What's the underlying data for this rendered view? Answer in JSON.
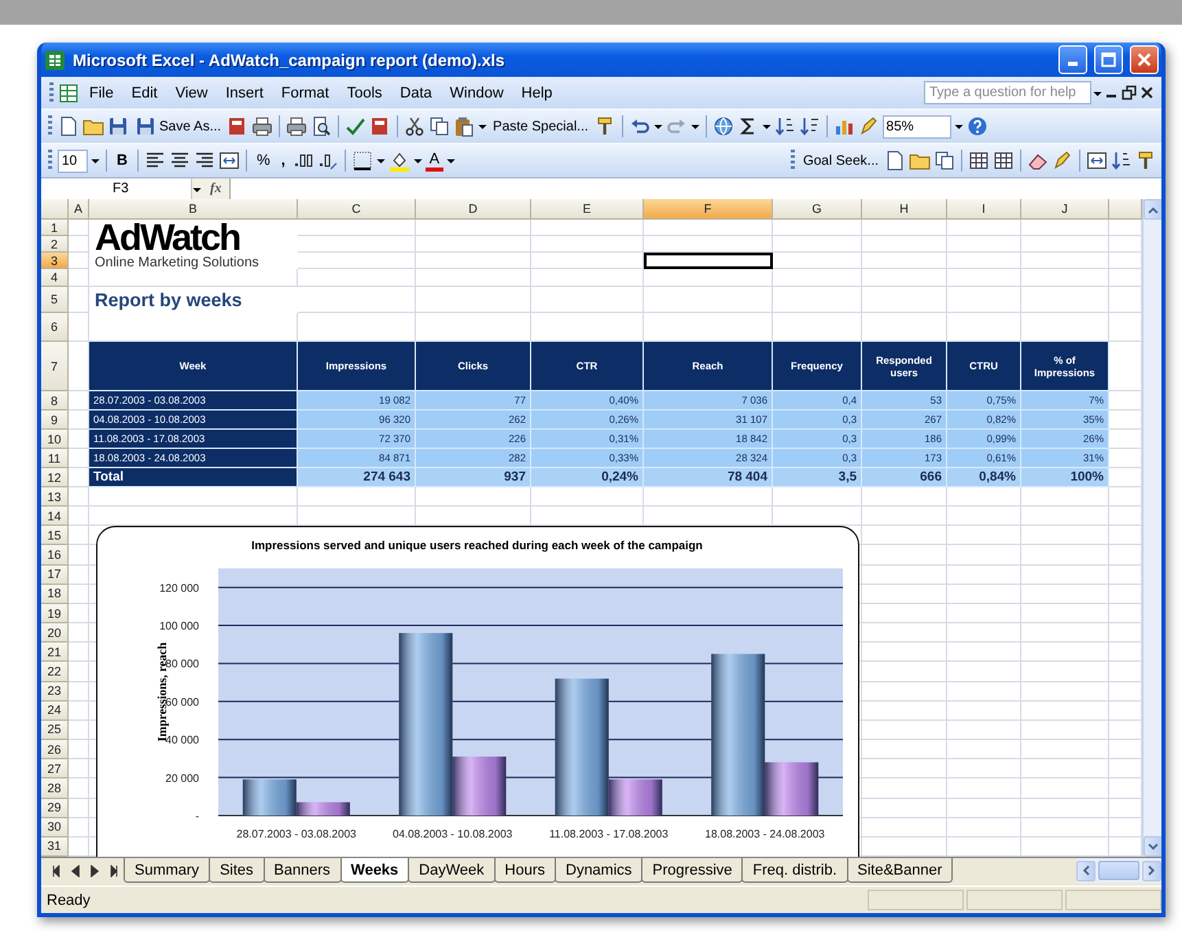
{
  "window": {
    "title": "Microsoft Excel - AdWatch_campaign report (demo).xls"
  },
  "menu": [
    "File",
    "Edit",
    "View",
    "Insert",
    "Format",
    "Tools",
    "Data",
    "Window",
    "Help"
  ],
  "help_box": {
    "placeholder": "Type a question for help"
  },
  "toolbar": {
    "save_as": "Save As...",
    "paste_special": "Paste Special...",
    "zoom": "85%"
  },
  "format_toolbar": {
    "font_size": "10",
    "bold": "B",
    "percent": "%",
    "comma": ",",
    "font_color": "A",
    "goal_seek": "Goal Seek..."
  },
  "formula_bar": {
    "name_box": "F3",
    "function": "fx"
  },
  "columns": [
    {
      "label": "A",
      "selected": false
    },
    {
      "label": "B",
      "selected": false
    },
    {
      "label": "C",
      "selected": false
    },
    {
      "label": "D",
      "selected": false
    },
    {
      "label": "E",
      "selected": false
    },
    {
      "label": "F",
      "selected": true
    },
    {
      "label": "G",
      "selected": false
    },
    {
      "label": "H",
      "selected": false
    },
    {
      "label": "I",
      "selected": false
    },
    {
      "label": "J",
      "selected": false
    }
  ],
  "rows": [
    {
      "label": "1",
      "selected": false
    },
    {
      "label": "2",
      "selected": false
    },
    {
      "label": "3",
      "selected": true
    },
    {
      "label": "4",
      "selected": false
    },
    {
      "label": "5",
      "selected": false
    },
    {
      "label": "6",
      "selected": false
    },
    {
      "label": "7",
      "selected": false
    },
    {
      "label": "8",
      "selected": false
    },
    {
      "label": "9",
      "selected": false
    },
    {
      "label": "10",
      "selected": false
    },
    {
      "label": "11",
      "selected": false
    },
    {
      "label": "12",
      "selected": false
    },
    {
      "label": "13",
      "selected": false
    },
    {
      "label": "14",
      "selected": false
    },
    {
      "label": "15",
      "selected": false
    },
    {
      "label": "16",
      "selected": false
    },
    {
      "label": "17",
      "selected": false
    },
    {
      "label": "18",
      "selected": false
    },
    {
      "label": "19",
      "selected": false
    },
    {
      "label": "20",
      "selected": false
    },
    {
      "label": "21",
      "selected": false
    },
    {
      "label": "22",
      "selected": false
    },
    {
      "label": "23",
      "selected": false
    },
    {
      "label": "24",
      "selected": false
    },
    {
      "label": "25",
      "selected": false
    },
    {
      "label": "26",
      "selected": false
    },
    {
      "label": "27",
      "selected": false
    },
    {
      "label": "28",
      "selected": false
    },
    {
      "label": "29",
      "selected": false
    },
    {
      "label": "30",
      "selected": false
    },
    {
      "label": "31",
      "selected": false
    }
  ],
  "logo": {
    "name": "AdWatch",
    "tagline": "Online Marketing Solutions"
  },
  "heading": "Report by weeks",
  "table": {
    "columns": [
      "Week",
      "Impressions",
      "Clicks",
      "CTR",
      "Reach",
      "Frequency",
      "Responded users",
      "CTRU",
      "% of Impressions"
    ],
    "rows": [
      {
        "cells": [
          "28.07.2003 - 03.08.2003",
          "19 082",
          "77",
          "0,40%",
          "7 036",
          "0,4",
          "53",
          "0,75%",
          "7%"
        ],
        "total": false
      },
      {
        "cells": [
          "04.08.2003 - 10.08.2003",
          "96 320",
          "262",
          "0,26%",
          "31 107",
          "0,3",
          "267",
          "0,82%",
          "35%"
        ],
        "total": false
      },
      {
        "cells": [
          "11.08.2003 - 17.08.2003",
          "72 370",
          "226",
          "0,31%",
          "18 842",
          "0,3",
          "186",
          "0,99%",
          "26%"
        ],
        "total": false
      },
      {
        "cells": [
          "18.08.2003 - 24.08.2003",
          "84 871",
          "282",
          "0,33%",
          "28 324",
          "0,3",
          "173",
          "0,61%",
          "31%"
        ],
        "total": false
      },
      {
        "cells": [
          "Total",
          "274 643",
          "937",
          "0,24%",
          "78 404",
          "3,5",
          "666",
          "0,84%",
          "100%"
        ],
        "total": true
      }
    ]
  },
  "chart_data": {
    "type": "bar",
    "title": "Impressions served and unique users reached during each week of the campaign",
    "ylabel": "Impressions, reach",
    "categories": [
      "28.07.2003 - 03.08.2003",
      "04.08.2003 - 10.08.2003",
      "11.08.2003 - 17.08.2003",
      "18.08.2003 - 24.08.2003"
    ],
    "series": [
      {
        "color": "#7fb2e6",
        "values": [
          19000,
          96000,
          72000,
          85000
        ]
      },
      {
        "color": "#c38aef",
        "values": [
          7000,
          31000,
          19000,
          28000
        ]
      }
    ],
    "grid": true,
    "ylim": [
      0,
      130000
    ],
    "yticks": [
      {
        "value": 0,
        "label": "-"
      },
      {
        "value": 20000,
        "label": "20 000"
      },
      {
        "value": 40000,
        "label": "40 000"
      },
      {
        "value": 60000,
        "label": "60 000"
      },
      {
        "value": 80000,
        "label": "80 000"
      },
      {
        "value": 100000,
        "label": "100 000"
      },
      {
        "value": 120000,
        "label": "120 000"
      }
    ]
  },
  "sheet_tabs": [
    {
      "label": "Summary",
      "selected": false
    },
    {
      "label": "Sites",
      "selected": false
    },
    {
      "label": "Banners",
      "selected": false
    },
    {
      "label": "Weeks",
      "selected": true
    },
    {
      "label": "DayWeek",
      "selected": false
    },
    {
      "label": "Hours",
      "selected": false
    },
    {
      "label": "Dynamics",
      "selected": false
    },
    {
      "label": "Progressive",
      "selected": false
    },
    {
      "label": "Freq. distrib.",
      "selected": false
    },
    {
      "label": "Site&Banner",
      "selected": false
    }
  ],
  "status_bar": "Ready"
}
